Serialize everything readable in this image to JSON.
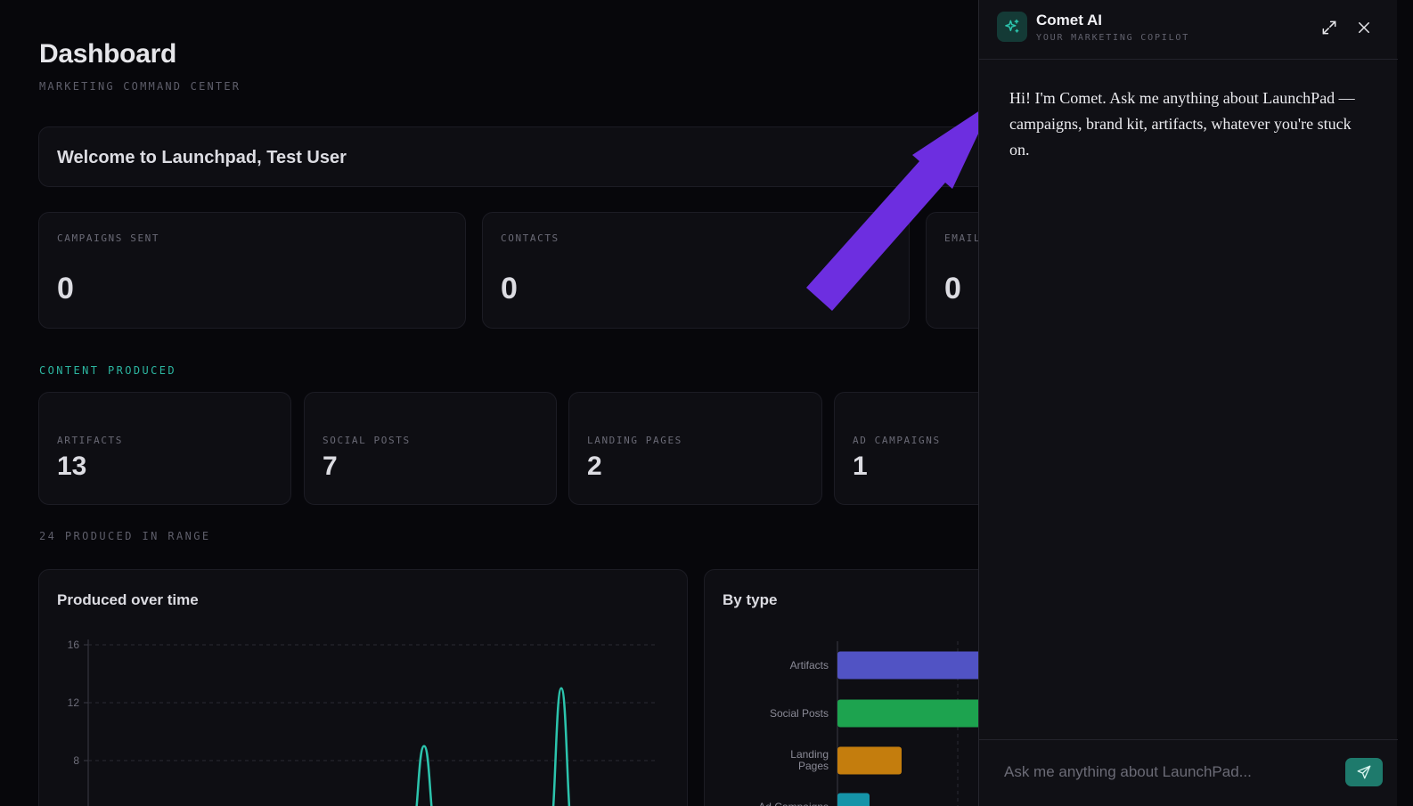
{
  "dashboard": {
    "title": "Dashboard",
    "subtitle": "MARKETING COMMAND CENTER",
    "welcome": "Welcome to Launchpad, Test User",
    "stats": [
      {
        "label": "CAMPAIGNS SENT",
        "value": "0"
      },
      {
        "label": "CONTACTS",
        "value": "0"
      },
      {
        "label": "EMAIL",
        "value": "0"
      }
    ],
    "content_section_label": "CONTENT PRODUCED",
    "content_stats": [
      {
        "label": "ARTIFACTS",
        "value": "13"
      },
      {
        "label": "SOCIAL POSTS",
        "value": "7"
      },
      {
        "label": "LANDING PAGES",
        "value": "2"
      },
      {
        "label": "AD CAMPAIGNS",
        "value": "1"
      }
    ],
    "range_label": "24 PRODUCED IN RANGE",
    "produced_over_time": {
      "title": "Produced over time"
    },
    "by_type": {
      "title": "By type"
    }
  },
  "chart_data": [
    {
      "type": "line",
      "title": "Produced over time",
      "yticks": [
        8,
        12,
        16
      ],
      "ylim": [
        0,
        16
      ],
      "grid": true,
      "color": "#2cc4ad",
      "peaks": [
        9,
        13
      ]
    },
    {
      "type": "bar",
      "orientation": "horizontal",
      "title": "By type",
      "categories": [
        "Artifacts",
        "Social Posts",
        "Landing Pages",
        "Ad Campaigns"
      ],
      "values": [
        13,
        7,
        2,
        1
      ],
      "colors": [
        "#5153c4",
        "#1da34f",
        "#c47d0d",
        "#1594a8"
      ]
    }
  ],
  "assistant": {
    "name": "Comet AI",
    "tagline": "YOUR MARKETING COPILOT",
    "message": "Hi! I'm Comet. Ask me anything about LaunchPad — campaigns, brand kit, artifacts, whatever you're stuck on.",
    "input_placeholder": "Ask me anything about LaunchPad...",
    "accent": "#1e7a6c"
  },
  "annotation": {
    "arrow_color": "#6d2ee0"
  }
}
